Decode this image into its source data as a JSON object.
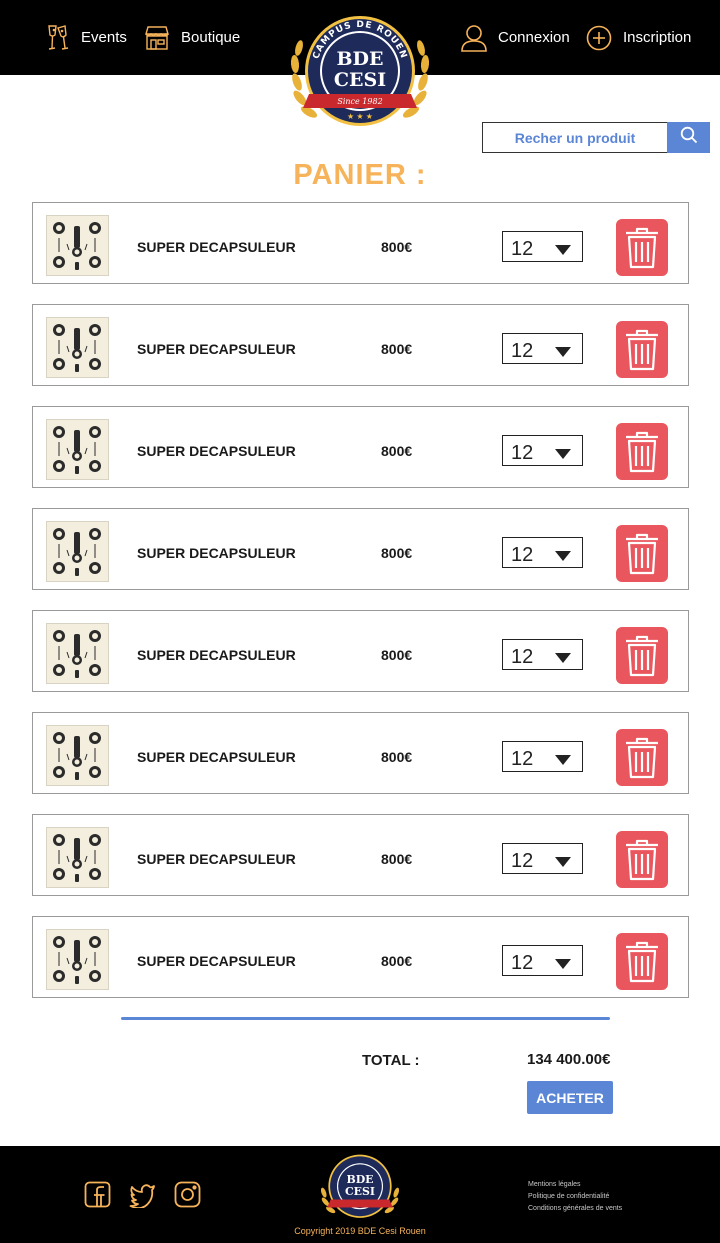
{
  "header": {
    "nav": [
      {
        "label": "Events",
        "icon": "champagne-glasses-icon"
      },
      {
        "label": "Boutique",
        "icon": "shop-icon"
      },
      {
        "label": "Connexion",
        "icon": "user-icon"
      },
      {
        "label": "Inscription",
        "icon": "plus-circle-icon"
      }
    ],
    "logo": {
      "ring_text": "CAMPUS DE ROUEN",
      "line1": "BDE",
      "line2": "CESI",
      "since": "Since 1982"
    }
  },
  "search": {
    "placeholder": "Recher un produit",
    "icon": "search-icon"
  },
  "page_title": "PANIER :",
  "cart": {
    "items": [
      {
        "name": "SUPER DECAPSULEUR",
        "price": "800€",
        "quantity": "12"
      },
      {
        "name": "SUPER DECAPSULEUR",
        "price": "800€",
        "quantity": "12"
      },
      {
        "name": "SUPER DECAPSULEUR",
        "price": "800€",
        "quantity": "12"
      },
      {
        "name": "SUPER DECAPSULEUR",
        "price": "800€",
        "quantity": "12"
      },
      {
        "name": "SUPER DECAPSULEUR",
        "price": "800€",
        "quantity": "12"
      },
      {
        "name": "SUPER DECAPSULEUR",
        "price": "800€",
        "quantity": "12"
      },
      {
        "name": "SUPER DECAPSULEUR",
        "price": "800€",
        "quantity": "12"
      },
      {
        "name": "SUPER DECAPSULEUR",
        "price": "800€",
        "quantity": "12"
      }
    ],
    "total_label": "TOTAL :",
    "total_value": "134 400.00€",
    "buy_label": "ACHETER"
  },
  "footer": {
    "social": [
      "facebook-icon",
      "twitter-icon",
      "instagram-icon"
    ],
    "copyright": "Copyright 2019 BDE Cesi Rouen",
    "links": [
      "Mentions légales",
      "Politique de confidentialité",
      "Conditions générales de vents"
    ]
  },
  "colors": {
    "accent_orange": "#f6b35a",
    "accent_blue": "#5b86d6",
    "delete_red": "#e9565d",
    "header_bg": "#000000"
  }
}
